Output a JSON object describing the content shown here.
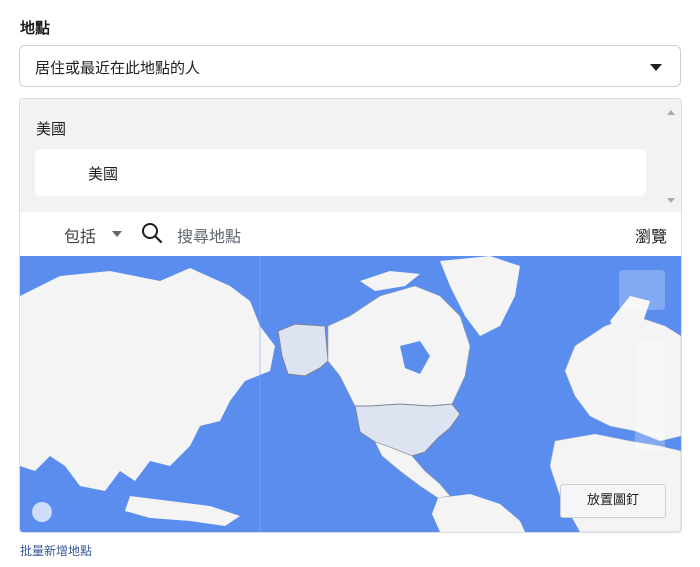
{
  "locations": {
    "label": "地點",
    "audience_select": {
      "value": "居住或最近在此地點的人",
      "icon": "caret-down-icon"
    },
    "selected_group": {
      "country_header": "美國",
      "items": [
        "美國"
      ]
    },
    "search": {
      "mode": "包括",
      "placeholder": "搜尋地點",
      "browse_label": "瀏覽"
    },
    "map": {
      "drop_pin_label": "放置圖釘",
      "colors": {
        "ocean": "#5b8def",
        "land": "#f4f4f4",
        "highlight": "#dde3f0"
      }
    },
    "bulk_add_link": "批量新增地點"
  }
}
